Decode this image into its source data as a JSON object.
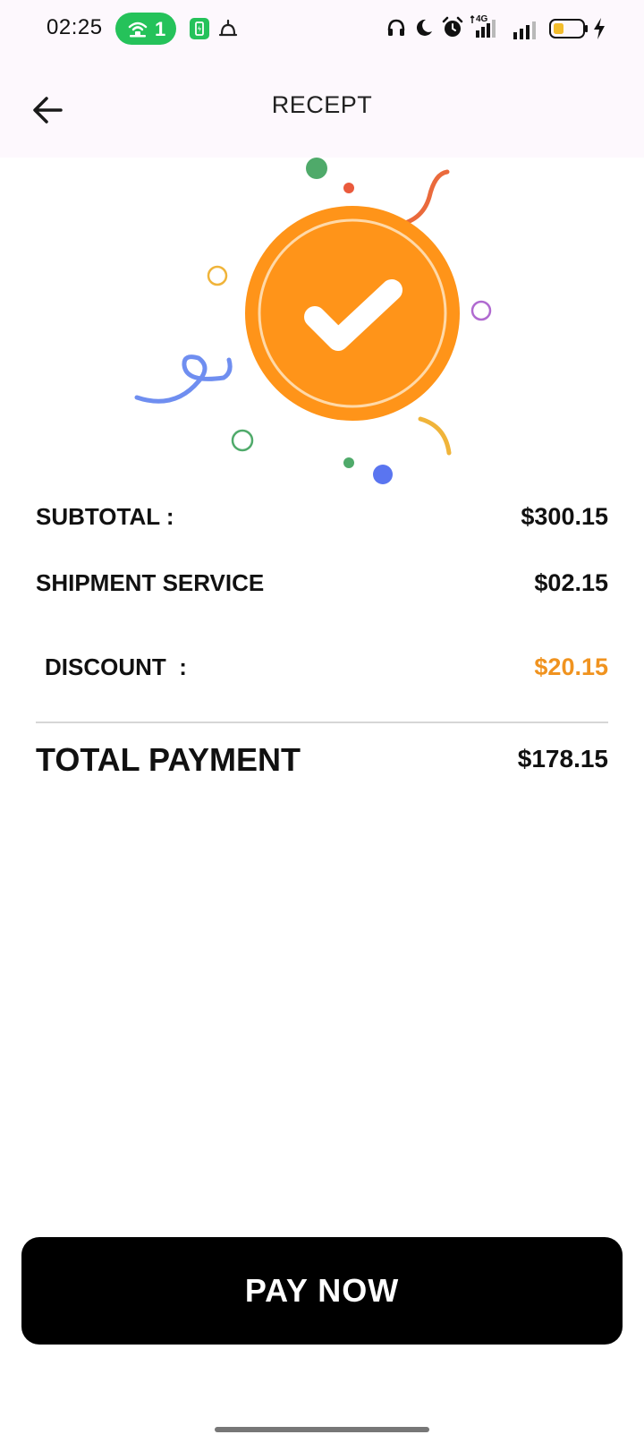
{
  "status_bar": {
    "time": "02:25",
    "hotspot_count": "1",
    "network_label": "4G",
    "icons": [
      "hotspot-icon",
      "battery-saver-icon",
      "notification-icon",
      "headphones-icon",
      "moon-icon",
      "alarm-icon",
      "signal-4g-icon",
      "signal-icon",
      "battery-icon",
      "charging-icon"
    ]
  },
  "app_bar": {
    "title": "RECEPT",
    "back_icon": "arrow-left-icon"
  },
  "illustration": {
    "icon": "check-circle-icon",
    "accent_color": "#ff9419"
  },
  "receipt": {
    "subtotal_label": "SUBTOTAL :",
    "subtotal_value": "$300.15",
    "shipment_label": "SHIPMENT SERVICE",
    "shipment_value": "$02.15",
    "discount_label": "DISCOUNT  :",
    "discount_value": "$20.15",
    "discount_color": "#f0931f",
    "total_label": "TOTAL PAYMENT",
    "total_value": "$178.15"
  },
  "actions": {
    "pay_label": "PAY NOW"
  }
}
